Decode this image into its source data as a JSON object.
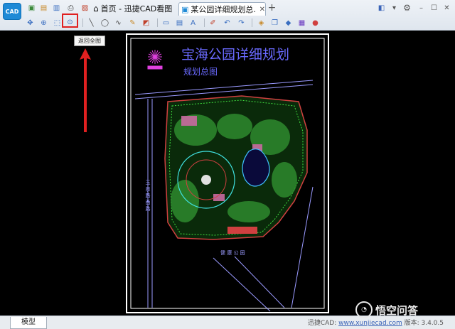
{
  "app": {
    "logo_text": "CAD"
  },
  "tabs": [
    {
      "label": "首页 - 迅捷CAD看图",
      "icon": "home-icon"
    },
    {
      "label": "某公园详细规划总...",
      "icon": "drawing-file-icon",
      "close": "✕"
    }
  ],
  "new_tab": "+",
  "toolbar_top_left": [
    "new-file-icon",
    "open-file-icon",
    "save-icon",
    "print-icon",
    "export-icon"
  ],
  "toolbar_tools": [
    "pan-icon",
    "zoom-window-icon",
    "zoom-extents-icon",
    "zoom-all-icon",
    "line-icon",
    "circle-icon",
    "arc-icon",
    "pencil-icon",
    "eraser-icon",
    "rectangle-icon",
    "text-box-icon",
    "text-icon",
    "eraser-icon",
    "undo-icon",
    "redo-icon",
    "layer-icon",
    "layers-panel-icon",
    "3d-cube-icon",
    "image-icon",
    "color-wheel-icon"
  ],
  "window_controls": [
    "pin-icon",
    "dropdown-icon",
    "settings-icon",
    "minimize-icon",
    "maximize-icon",
    "close-icon"
  ],
  "tooltip": {
    "text": "返回全图"
  },
  "drawing": {
    "title": "宝海公园详细规划",
    "subtitle": "规划总图",
    "left_road_label": "玉 泉 路 西 路",
    "bottom_label": "健 康 公 园"
  },
  "status": {
    "model_tab": "模型",
    "prefix": "迅捷CAD: ",
    "link": "www.xunjiecad.com",
    "version": " 版本: 3.4.0.5"
  },
  "watermark": {
    "text": "悟空问答",
    "icon": "wukong-icon"
  },
  "colors": {
    "highlight": "#e02020",
    "canvas": "#000000",
    "accent": "#1f8ad6"
  }
}
